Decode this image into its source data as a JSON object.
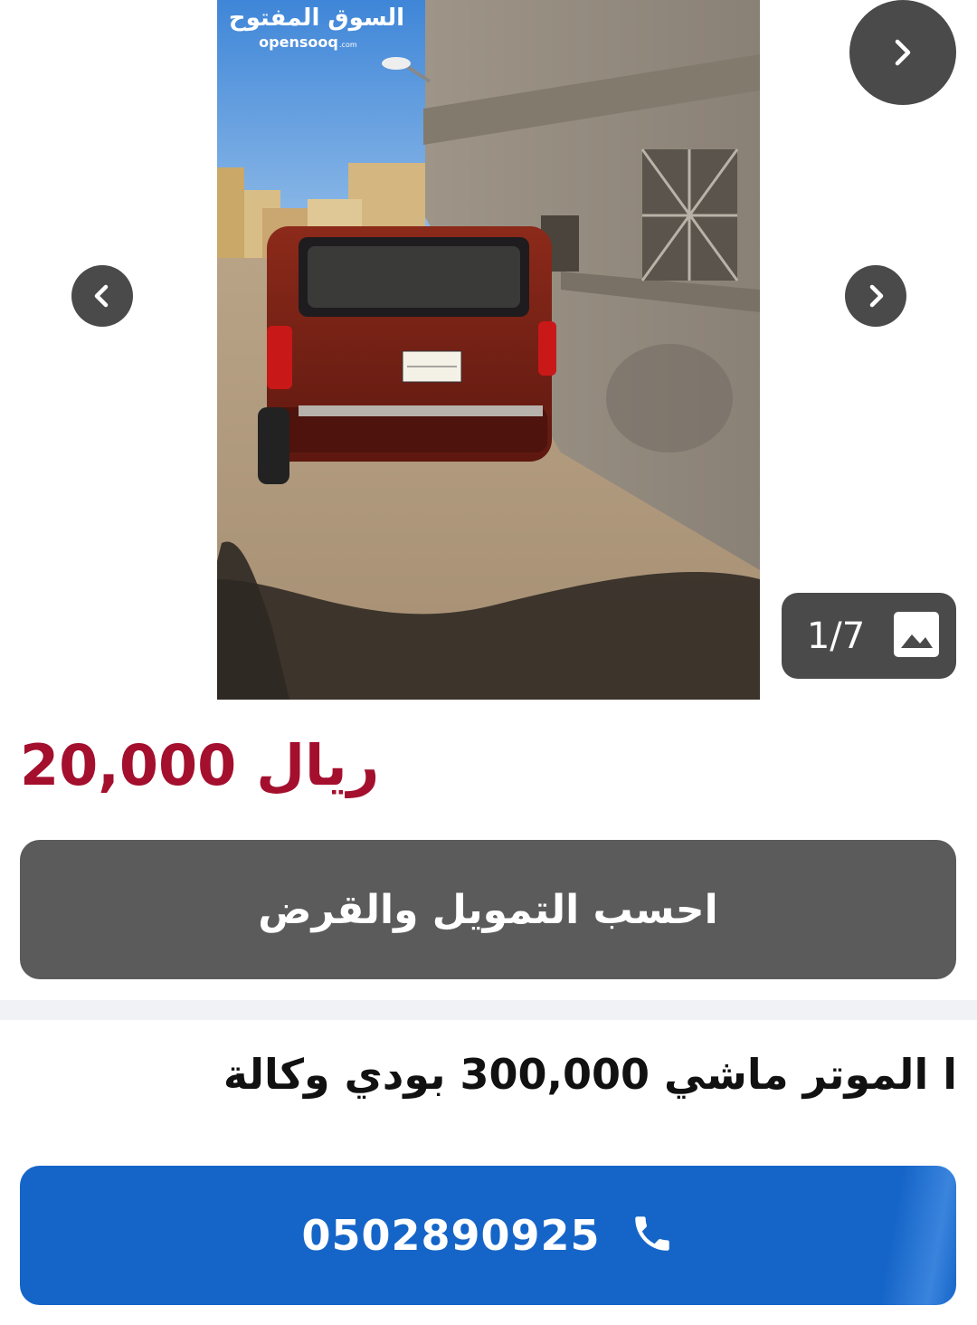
{
  "gallery": {
    "watermark_arabic": "السوق المفتوح",
    "watermark_latin": "opensooq",
    "watermark_suffix": ".com",
    "counter": "1/7",
    "image_index": 1,
    "image_total": 7
  },
  "listing": {
    "price_value": "20,000",
    "price_currency": "ريال",
    "finance_button_label": "احسب التمويل والقرض",
    "title": "ا الموتر ماشي 300,000 بودي وكالة",
    "call_number": "0502890925"
  },
  "colors": {
    "price": "#a40f2e",
    "finance_button": "#5b5b5b",
    "call_button": "#1565c8",
    "nav_button": "#4a4a4a",
    "divider": "#f1f2f6"
  },
  "icons": {
    "next": "chevron-right-icon",
    "prev": "chevron-left-icon",
    "gallery": "image-icon",
    "call": "phone-icon"
  }
}
